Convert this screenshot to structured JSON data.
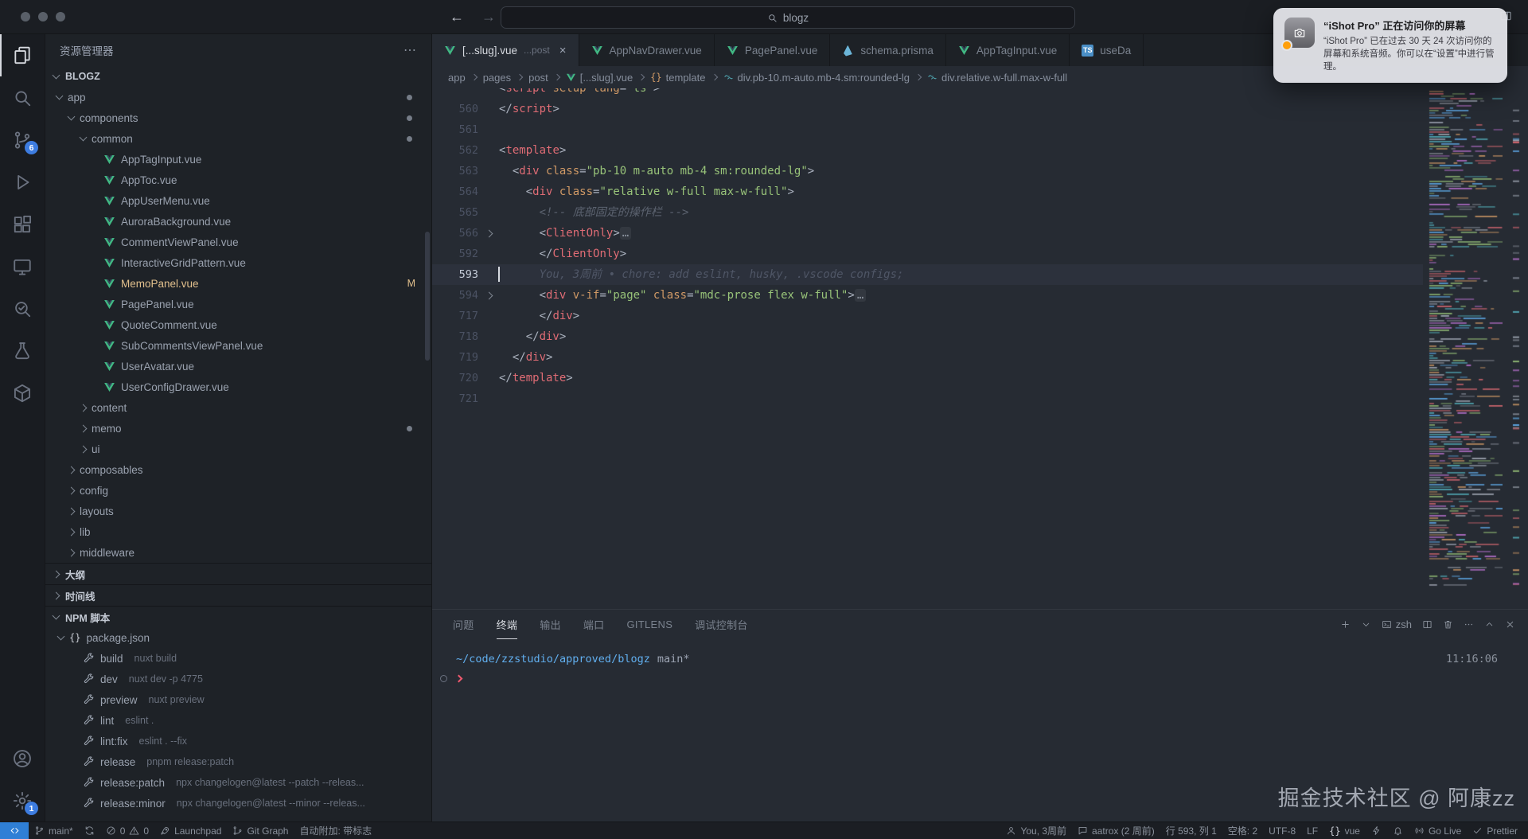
{
  "titlebar": {
    "search": "blogz",
    "back": "←",
    "forward": "→"
  },
  "notification": {
    "title": "“iShot Pro” 正在访问你的屏幕",
    "body": "“iShot Pro” 已在过去 30 天 24 次访问你的屏幕和系统音频。你可以在“设置”中进行管理。"
  },
  "activity_bar": {
    "top": [
      {
        "name": "explorer",
        "icon": "files",
        "active": true
      },
      {
        "name": "search",
        "icon": "search"
      },
      {
        "name": "source-control",
        "icon": "scm",
        "badge": "6"
      },
      {
        "name": "run-debug",
        "icon": "debug"
      },
      {
        "name": "extensions",
        "icon": "extensions"
      },
      {
        "name": "remote-explorer",
        "icon": "remote"
      },
      {
        "name": "gitlens",
        "icon": "gitlens"
      },
      {
        "name": "testing",
        "icon": "testing"
      },
      {
        "name": "docker",
        "icon": "docker"
      }
    ],
    "bottom": [
      {
        "name": "accounts",
        "icon": "account"
      },
      {
        "name": "settings",
        "icon": "gear",
        "badge": "1"
      }
    ]
  },
  "sidebar": {
    "title": "资源管理器",
    "project": "BLOGZ",
    "outline_label": "大纲",
    "timeline_label": "时间线",
    "npm_label": "NPM 脚本",
    "tree": [
      {
        "label": "app",
        "type": "folder",
        "expanded": true,
        "indent": 0,
        "badge": "dot"
      },
      {
        "label": "components",
        "type": "folder",
        "expanded": true,
        "indent": 1,
        "badge": "dot"
      },
      {
        "label": "common",
        "type": "folder",
        "expanded": true,
        "indent": 2,
        "badge": "dot"
      },
      {
        "label": "AppTagInput.vue",
        "type": "vue",
        "indent": 3
      },
      {
        "label": "AppToc.vue",
        "type": "vue",
        "indent": 3
      },
      {
        "label": "AppUserMenu.vue",
        "type": "vue",
        "indent": 3
      },
      {
        "label": "AuroraBackground.vue",
        "type": "vue",
        "indent": 3
      },
      {
        "label": "CommentViewPanel.vue",
        "type": "vue",
        "indent": 3
      },
      {
        "label": "InteractiveGridPattern.vue",
        "type": "vue",
        "indent": 3
      },
      {
        "label": "MemoPanel.vue",
        "type": "vue",
        "indent": 3,
        "modified": true,
        "badge": "M"
      },
      {
        "label": "PagePanel.vue",
        "type": "vue",
        "indent": 3
      },
      {
        "label": "QuoteComment.vue",
        "type": "vue",
        "indent": 3
      },
      {
        "label": "SubCommentsViewPanel.vue",
        "type": "vue",
        "indent": 3
      },
      {
        "label": "UserAvatar.vue",
        "type": "vue",
        "indent": 3
      },
      {
        "label": "UserConfigDrawer.vue",
        "type": "vue",
        "indent": 3
      },
      {
        "label": "content",
        "type": "folder",
        "expanded": false,
        "indent": 2
      },
      {
        "label": "memo",
        "type": "folder",
        "expanded": false,
        "indent": 2,
        "badge": "dot"
      },
      {
        "label": "ui",
        "type": "folder",
        "expanded": false,
        "indent": 2
      },
      {
        "label": "composables",
        "type": "folder",
        "expanded": false,
        "indent": 1
      },
      {
        "label": "config",
        "type": "folder",
        "expanded": false,
        "indent": 1
      },
      {
        "label": "layouts",
        "type": "folder",
        "expanded": false,
        "indent": 1
      },
      {
        "label": "lib",
        "type": "folder",
        "expanded": false,
        "indent": 1
      },
      {
        "label": "middleware",
        "type": "folder",
        "expanded": false,
        "indent": 1
      }
    ],
    "npm_items": [
      {
        "label": "package.json",
        "icon": "braces",
        "expanded": true,
        "indent": 0
      },
      {
        "label": "build",
        "detail": "nuxt build",
        "indent": 1
      },
      {
        "label": "dev",
        "detail": "nuxt dev -p 4775",
        "indent": 1
      },
      {
        "label": "preview",
        "detail": "nuxt preview",
        "indent": 1
      },
      {
        "label": "lint",
        "detail": "eslint .",
        "indent": 1
      },
      {
        "label": "lint:fix",
        "detail": "eslint . --fix",
        "indent": 1
      },
      {
        "label": "release",
        "detail": "pnpm release:patch",
        "indent": 1
      },
      {
        "label": "release:patch",
        "detail": "npx changelogen@latest --patch --releas...",
        "indent": 1
      },
      {
        "label": "release:minor",
        "detail": "npx changelogen@latest --minor --releas...",
        "indent": 1
      }
    ]
  },
  "tabs": [
    {
      "label": "[...slug].vue",
      "hint": "...post",
      "icon": "vue",
      "active": true,
      "close": true
    },
    {
      "label": "AppNavDrawer.vue",
      "icon": "vue"
    },
    {
      "label": "PagePanel.vue",
      "icon": "vue"
    },
    {
      "label": "schema.prisma",
      "icon": "prisma"
    },
    {
      "label": "AppTagInput.vue",
      "icon": "vue"
    },
    {
      "label": "useDa",
      "icon": "ts"
    }
  ],
  "breadcrumbs": [
    {
      "label": "app"
    },
    {
      "label": "pages"
    },
    {
      "label": "post"
    },
    {
      "label": "[...slug].vue",
      "icon": "vue"
    },
    {
      "label": "template",
      "icon": "braces"
    },
    {
      "label": "div.pb-10.m-auto.mb-4.sm:rounded-lg",
      "icon": "tailwind"
    },
    {
      "label": "div.relative.w-full.max-w-full",
      "icon": "tailwind"
    }
  ],
  "editor": {
    "lines": [
      {
        "num": "",
        "half": true,
        "tokens": [
          [
            "p",
            "<"
          ],
          [
            "tag",
            "script"
          ],
          [
            "attr",
            " setup"
          ],
          [
            "attr",
            " lang"
          ],
          [
            "p",
            "="
          ],
          [
            "str",
            "\"ts\""
          ],
          [
            "p",
            ">"
          ]
        ]
      },
      {
        "num": 560,
        "tokens": [
          [
            "p",
            "</"
          ],
          [
            "tag",
            "script"
          ],
          [
            "p",
            ">"
          ]
        ]
      },
      {
        "num": 561,
        "tokens": []
      },
      {
        "num": 562,
        "tokens": [
          [
            "p",
            "<"
          ],
          [
            "tag",
            "template"
          ],
          [
            "p",
            ">"
          ]
        ]
      },
      {
        "num": 563,
        "tokens": [
          [
            "p",
            "  <"
          ],
          [
            "tag",
            "div"
          ],
          [
            "attr",
            " class"
          ],
          [
            "p",
            "="
          ],
          [
            "str",
            "\"pb-10 m-auto mb-4 sm:rounded-lg\""
          ],
          [
            "p",
            ">"
          ]
        ]
      },
      {
        "num": 564,
        "tokens": [
          [
            "p",
            "    <"
          ],
          [
            "tag",
            "div"
          ],
          [
            "attr",
            " class"
          ],
          [
            "p",
            "="
          ],
          [
            "str",
            "\"relative w-full max-w-full\""
          ],
          [
            "p",
            ">"
          ]
        ]
      },
      {
        "num": 565,
        "tokens": [
          [
            "com",
            "      <!-- 底部固定的操作栏 -->"
          ]
        ]
      },
      {
        "num": 566,
        "fold": true,
        "tokens": [
          [
            "p",
            "      <"
          ],
          [
            "tag",
            "ClientOnly"
          ],
          [
            "p",
            ">"
          ],
          [
            "dots",
            "…"
          ]
        ]
      },
      {
        "num": 592,
        "tokens": [
          [
            "p",
            "      </"
          ],
          [
            "tag",
            "ClientOnly"
          ],
          [
            "p",
            ">"
          ]
        ]
      },
      {
        "num": 593,
        "current": true,
        "tokens": [
          [
            "blame",
            "      You, 3周前 • chore: add eslint, husky, .vscode configs;"
          ]
        ]
      },
      {
        "num": 594,
        "fold": true,
        "tokens": [
          [
            "p",
            "      <"
          ],
          [
            "tag",
            "div"
          ],
          [
            "attr",
            " v-if"
          ],
          [
            "p",
            "="
          ],
          [
            "str",
            "\"page\""
          ],
          [
            "attr",
            " class"
          ],
          [
            "p",
            "="
          ],
          [
            "str",
            "\"mdc-prose flex w-full\""
          ],
          [
            "p",
            ">"
          ],
          [
            "dots",
            "…"
          ]
        ]
      },
      {
        "num": 717,
        "tokens": [
          [
            "p",
            "      </"
          ],
          [
            "tag",
            "div"
          ],
          [
            "p",
            ">"
          ]
        ]
      },
      {
        "num": 718,
        "tokens": [
          [
            "p",
            "    </"
          ],
          [
            "tag",
            "div"
          ],
          [
            "p",
            ">"
          ]
        ]
      },
      {
        "num": 719,
        "tokens": [
          [
            "p",
            "  </"
          ],
          [
            "tag",
            "div"
          ],
          [
            "p",
            ">"
          ]
        ]
      },
      {
        "num": 720,
        "tokens": [
          [
            "p",
            "</"
          ],
          [
            "tag",
            "template"
          ],
          [
            "p",
            ">"
          ]
        ]
      },
      {
        "num": 721,
        "tokens": []
      }
    ]
  },
  "panel": {
    "tabs": [
      "问题",
      "终端",
      "输出",
      "端口",
      "GITLENS",
      "调试控制台"
    ],
    "active_tab": "终端",
    "actions": [
      {
        "name": "new-terminal",
        "icon": "plus"
      },
      {
        "name": "launch-profile",
        "icon": "chevdown"
      },
      {
        "name": "terminal-shell",
        "icon": "terminal",
        "label": "zsh"
      },
      {
        "name": "split-terminal",
        "icon": "split"
      },
      {
        "name": "kill-terminal",
        "icon": "trash"
      },
      {
        "name": "more-actions",
        "icon": "ellipsis"
      },
      {
        "name": "maximize-panel",
        "icon": "chevup"
      },
      {
        "name": "close-panel",
        "icon": "close"
      }
    ],
    "terminal": {
      "cwd": "~/code/zzstudio/approved/blogz",
      "branch": "main*",
      "time": "11:16:06"
    }
  },
  "statusbar": {
    "left": [
      {
        "name": "remote-indicator",
        "icon": "remotesym",
        "remote": true
      },
      {
        "name": "git-branch",
        "icon": "branch",
        "label": "main*"
      },
      {
        "name": "sync",
        "icon": "sync"
      },
      {
        "name": "problems",
        "segments": [
          {
            "icon": "error",
            "label": "0"
          },
          {
            "icon": "warn",
            "label": "0"
          }
        ]
      },
      {
        "name": "launchpad",
        "icon": "rocket",
        "label": "Launchpad"
      },
      {
        "name": "git-graph",
        "icon": "graph",
        "label": "Git Graph"
      },
      {
        "name": "auto-attach",
        "label": "自动附加: 带标志"
      }
    ],
    "right": [
      {
        "name": "gitlens-blame",
        "icon": "person",
        "label": "You, 3周前"
      },
      {
        "name": "commit-author",
        "icon": "comment",
        "label": "aatrox (2 周前)"
      },
      {
        "name": "cursor-position",
        "label": "行 593, 列 1"
      },
      {
        "name": "indentation",
        "label": "空格: 2"
      },
      {
        "name": "encoding",
        "label": "UTF-8"
      },
      {
        "name": "eol",
        "label": "LF"
      },
      {
        "name": "language-mode",
        "icon": "bracessm",
        "label": "vue"
      },
      {
        "name": "feedback",
        "icon": "zap"
      },
      {
        "name": "notifications",
        "icon": "bell"
      },
      {
        "name": "go-live",
        "icon": "broadcast",
        "label": "Go Live"
      },
      {
        "name": "prettier",
        "icon": "check",
        "label": "Prettier"
      }
    ]
  },
  "watermark": "掘金技术社区 @ 阿康zz"
}
